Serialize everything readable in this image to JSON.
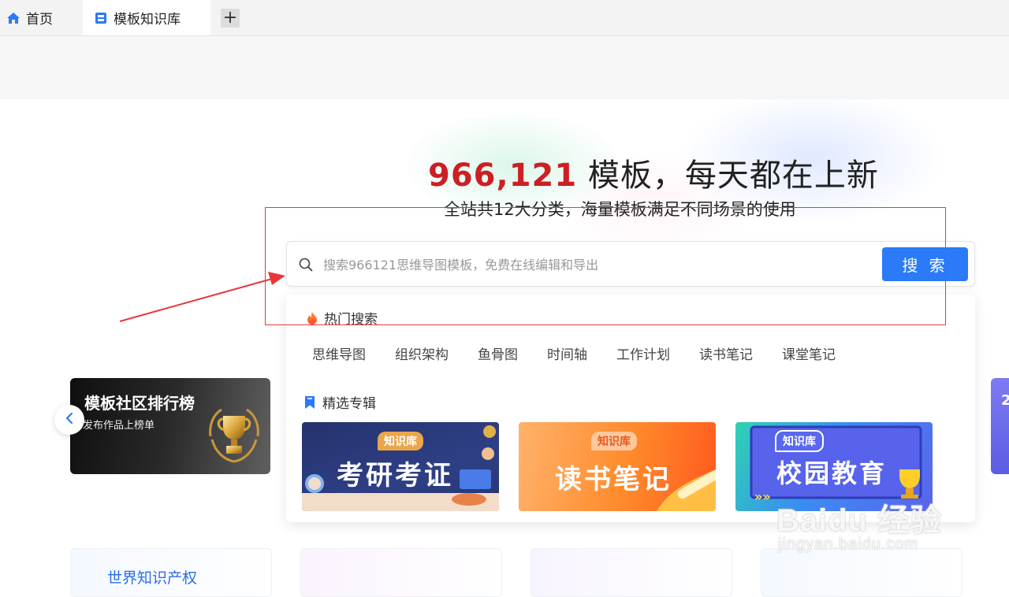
{
  "tabs": {
    "home_label": "首页",
    "active_label": "模板知识库",
    "add_symbol": "+"
  },
  "hero": {
    "count": "966,121",
    "title_rest": " 模板，每天都在上新",
    "subtitle": "全站共12大分类，海量模板满足不同场景的使用"
  },
  "search": {
    "placeholder": "搜索966121思维导图模板，免费在线编辑和导出",
    "button_label": "搜 索"
  },
  "dropdown": {
    "hot_title": "热门搜索",
    "hot_items": [
      "思维导图",
      "组织架构",
      "鱼骨图",
      "时间轴",
      "工作计划",
      "读书笔记",
      "课堂笔记"
    ],
    "featured_title": "精选专辑",
    "cards": [
      {
        "badge": "知识库",
        "title": "考研考证"
      },
      {
        "badge": "知识库",
        "title": "读书笔记"
      },
      {
        "badge": "知识库",
        "title": "校园教育"
      }
    ]
  },
  "promo": {
    "title": "模板社区排行榜",
    "subtitle": "发布作品上榜单"
  },
  "right_peek_text": "2",
  "bottom_cards": [
    {
      "title": "世界知识产权"
    }
  ],
  "watermark": {
    "main": "Baidu 经验",
    "url": "jingyan.baidu.com"
  },
  "colors": {
    "accent": "#2b7af7",
    "count_red": "#cc1f24",
    "annotation_red": "#e8383d"
  }
}
